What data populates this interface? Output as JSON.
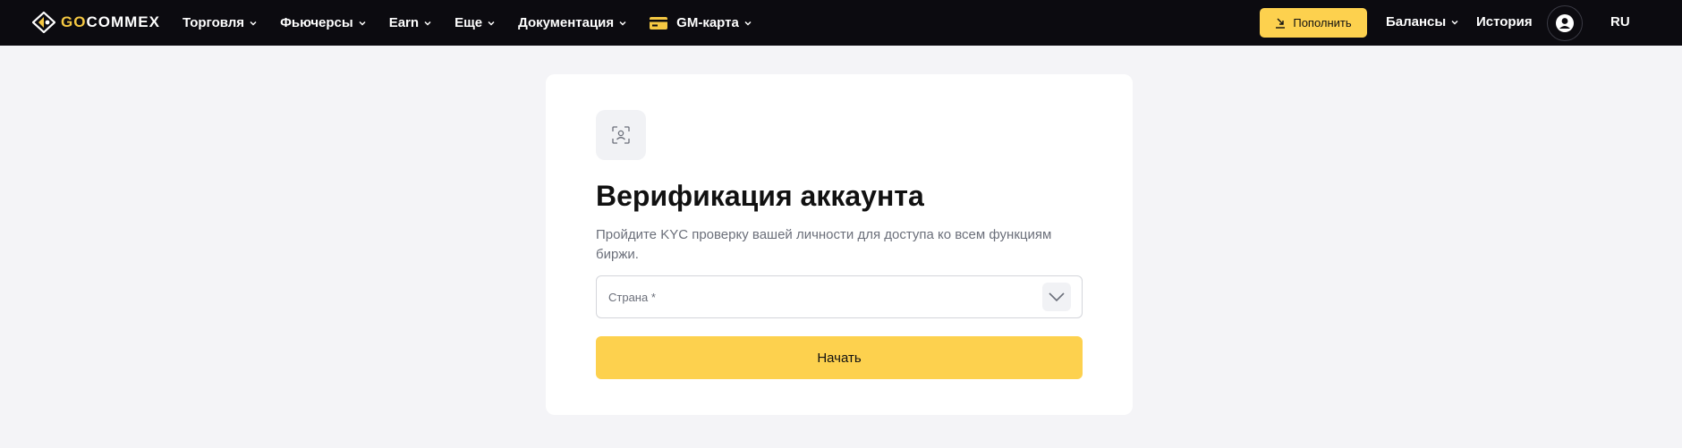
{
  "colors": {
    "header_bg": "#0c0b10",
    "accent": "#fdd14e",
    "page_bg": "#f4f4f7",
    "card_bg": "#ffffff",
    "muted_text": "#6b6f7a"
  },
  "header": {
    "logo_go": "GO",
    "logo_rest": "COMMEX",
    "nav": [
      {
        "label": "Торговля",
        "icon": "chevron-down-icon"
      },
      {
        "label": "Фьючерсы",
        "icon": "chevron-down-icon"
      },
      {
        "label": "Earn",
        "icon": "chevron-down-icon"
      },
      {
        "label": "Еще",
        "icon": "chevron-down-icon"
      },
      {
        "label": "Документация",
        "icon": "chevron-down-icon"
      },
      {
        "label": "GM-карта",
        "icon": "chevron-down-icon"
      }
    ],
    "deposit_label": "Пополнить",
    "balances_label": "Балансы",
    "history_label": "История",
    "lang_label": "RU"
  },
  "main": {
    "title": "Верификация аккаунта",
    "subtitle": "Пройдите KYC проверку вашей личности для доступа ко всем функциям биржи.",
    "country_placeholder": "Страна *",
    "start_label": "Начать"
  }
}
